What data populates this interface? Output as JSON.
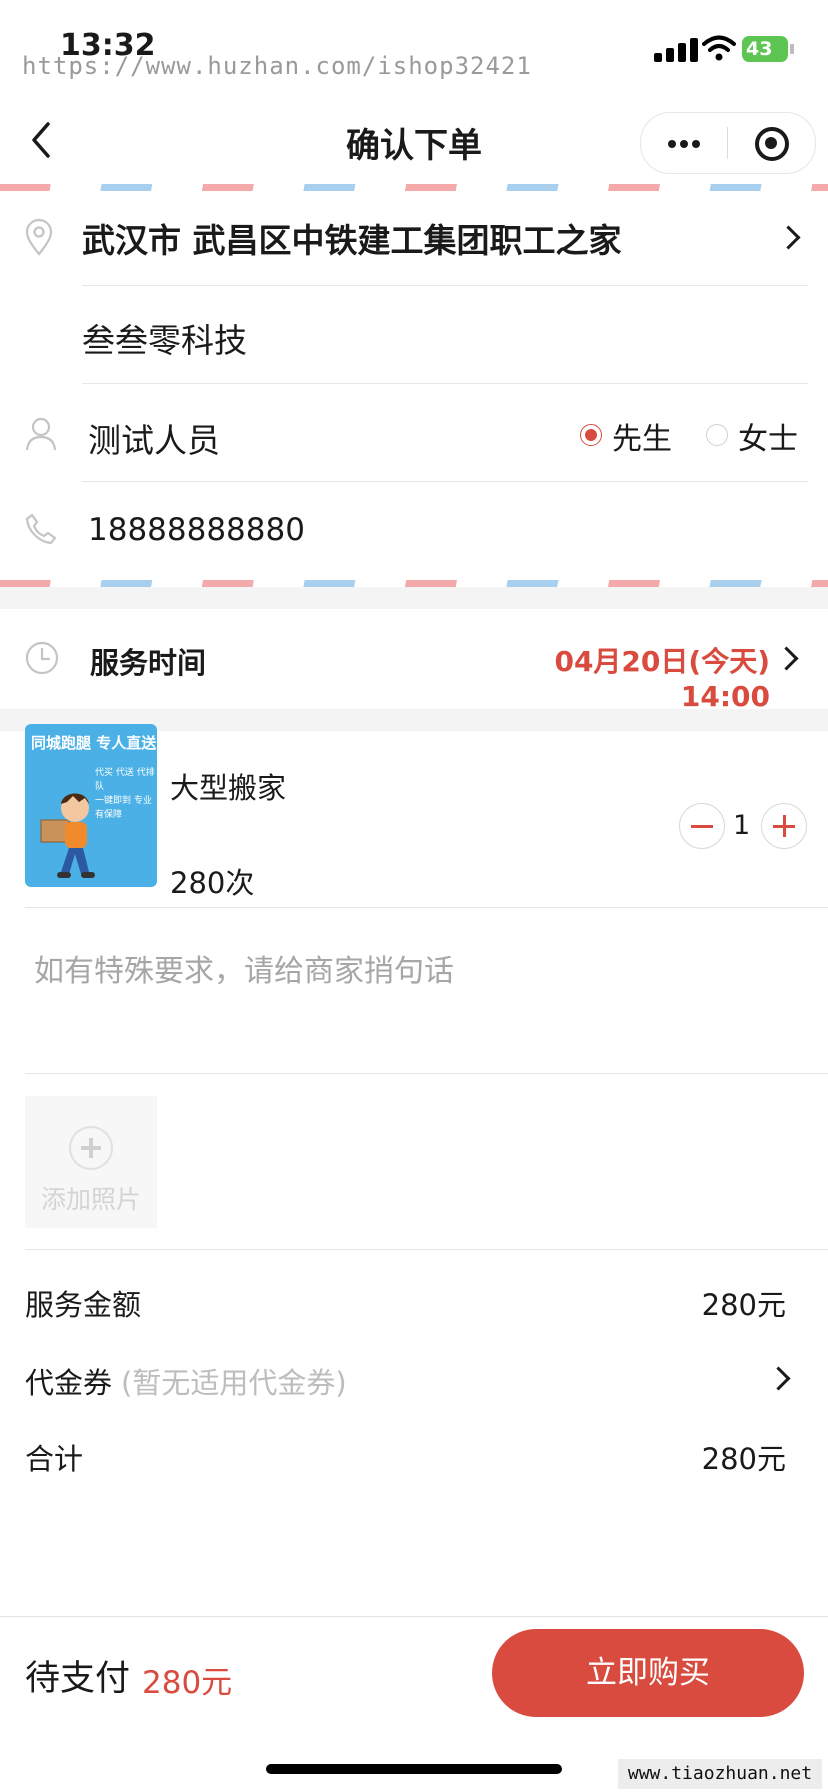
{
  "status_bar": {
    "time": "13:32",
    "battery": "43",
    "watermark": "https://www.huzhan.com/ishop32421"
  },
  "nav": {
    "title": "确认下单"
  },
  "address": {
    "main": "武汉市 武昌区中铁建工集团职工之家",
    "detail": "叁叁零科技",
    "contact_name": "测试人员",
    "gender_options": [
      "先生",
      "女士"
    ],
    "gender_selected": "先生",
    "phone": "18888888880"
  },
  "service_time": {
    "label": "服务时间",
    "value": "04月20日(今天) 14:00"
  },
  "product": {
    "thumbnail_banner": "同城跑腿  专人直送",
    "thumbnail_sub": "代买 代送 代排队\n一键即到 专业有保障",
    "name": "大型搬家",
    "price": "280次",
    "quantity": "1"
  },
  "remark": {
    "placeholder": "如有特殊要求，请给商家捎句话"
  },
  "add_photo": {
    "label": "添加照片"
  },
  "fees": {
    "service_amount_label": "服务金额",
    "service_amount_value": "280元",
    "coupon_label": "代金券",
    "coupon_hint": "(暂无适用代金券)",
    "total_label": "合计",
    "total_value": "280元"
  },
  "bottom_bar": {
    "pending_label": "待支付",
    "pending_amount": "280元",
    "buy_button": "立即购买",
    "watermark": "www.tiaozhuan.net"
  },
  "colors": {
    "accent": "#d84b3e",
    "divider": "#e6e6e6",
    "section_gap": "#f4f4f4",
    "stripe_red": "#f4aaaa",
    "stripe_blue": "#a8d0ee"
  },
  "icons": [
    "back-arrow-icon",
    "more-dots-icon",
    "close-mini-program-icon",
    "location-pin-icon",
    "chevron-right-icon",
    "person-icon",
    "phone-icon",
    "clock-icon",
    "minus-icon",
    "plus-icon",
    "add-photo-plus-icon"
  ]
}
